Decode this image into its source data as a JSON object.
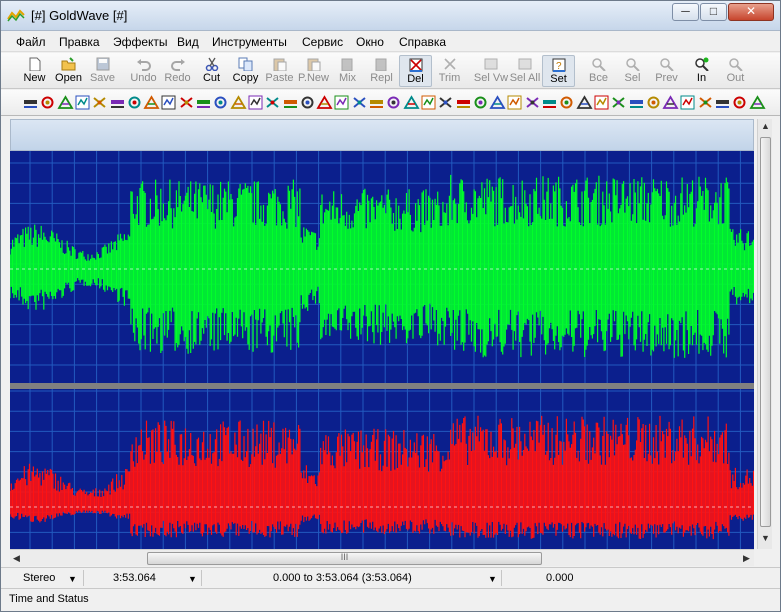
{
  "window": {
    "title": "[#] GoldWave [#]",
    "minimize_glyph": "─",
    "maximize_glyph": "□",
    "close_glyph": "✕"
  },
  "menu": [
    "Файл",
    "Правка",
    "Эффекты",
    "Вид",
    "Инструменты",
    "Сервис",
    "Окно",
    "Справка"
  ],
  "toolbar": [
    {
      "label": "New",
      "icon": "new-file-icon",
      "enabled": true
    },
    {
      "label": "Open",
      "icon": "open-folder-icon",
      "enabled": true
    },
    {
      "label": "Save",
      "icon": "save-disk-icon",
      "enabled": false
    },
    {
      "label": "Undo",
      "icon": "undo-icon",
      "enabled": false
    },
    {
      "label": "Redo",
      "icon": "redo-icon",
      "enabled": false
    },
    {
      "label": "Cut",
      "icon": "scissors-icon",
      "enabled": true
    },
    {
      "label": "Copy",
      "icon": "copy-icon",
      "enabled": true
    },
    {
      "label": "Paste",
      "icon": "paste-icon",
      "enabled": false
    },
    {
      "label": "P.New",
      "icon": "paste-new-icon",
      "enabled": false
    },
    {
      "label": "Mix",
      "icon": "mix-icon",
      "enabled": false
    },
    {
      "label": "Repl",
      "icon": "replace-icon",
      "enabled": false
    },
    {
      "label": "Del",
      "icon": "delete-icon",
      "enabled": true
    },
    {
      "label": "Trim",
      "icon": "trim-icon",
      "enabled": false
    },
    {
      "label": "Sel Vw",
      "icon": "select-view-icon",
      "enabled": false
    },
    {
      "label": "Sel All",
      "icon": "select-all-icon",
      "enabled": false
    },
    {
      "label": "Set",
      "icon": "set-marker-icon",
      "enabled": true
    },
    {
      "label": "Все",
      "icon": "zoom-all-icon",
      "enabled": false
    },
    {
      "label": "Sel",
      "icon": "zoom-selection-icon",
      "enabled": false
    },
    {
      "label": "Prev",
      "icon": "zoom-previous-icon",
      "enabled": false
    },
    {
      "label": "In",
      "icon": "zoom-in-icon",
      "enabled": true
    },
    {
      "label": "Out",
      "icon": "zoom-out-icon",
      "enabled": false
    }
  ],
  "effects_toolbar_icons": [
    "dc-offset-icon",
    "doppler-icon",
    "echo-icon",
    "envelope-icon",
    "expand-icon",
    "fade-in-icon",
    "fade-out-icon",
    "filter-icon",
    "flanger-icon",
    "interpolate-icon",
    "invert-icon",
    "mechanize-icon",
    "offset-icon",
    "pan-icon",
    "pitch-icon",
    "playback-rate-icon",
    "resample-icon",
    "reverb-icon",
    "reverse-icon",
    "silence-icon",
    "spectrum-filter-icon",
    "time-warp-icon",
    "volume-change-icon",
    "volume-shape-icon",
    "auto-gain-icon",
    "compressor-icon",
    "equalizer-icon",
    "noise-reduction-icon",
    "pop-click-icon",
    "channel-mix-icon",
    "mute-icon",
    "matcher-icon",
    "maximize-icon",
    "normalize-icon",
    "loop-icon",
    "cue-icon",
    "marker-icon",
    "voice-icon",
    "stereo-icon",
    "mono-icon",
    "no-icon",
    "diamond-icon",
    "play-hz-icon"
  ],
  "waveform": {
    "background_color": "#0b1f8d",
    "grid_color": "#2a6ed0",
    "left_channel_color": "#00ff2a",
    "right_channel_color": "#ff1212",
    "channel_separator_color": "#808080"
  },
  "scroll": {
    "thumb_grip": "III",
    "left_arrow": "◀",
    "right_arrow": "▶",
    "up_arrow": "▲",
    "down_arrow": "▼"
  },
  "status": {
    "channels": "Stereo",
    "length": "3:53.064",
    "selection": "0.000 to 3:53.064 (3:53.064)",
    "position": "0.000",
    "dropdown_glyph": "▼"
  },
  "statusbar2": {
    "text": "Time and Status"
  }
}
